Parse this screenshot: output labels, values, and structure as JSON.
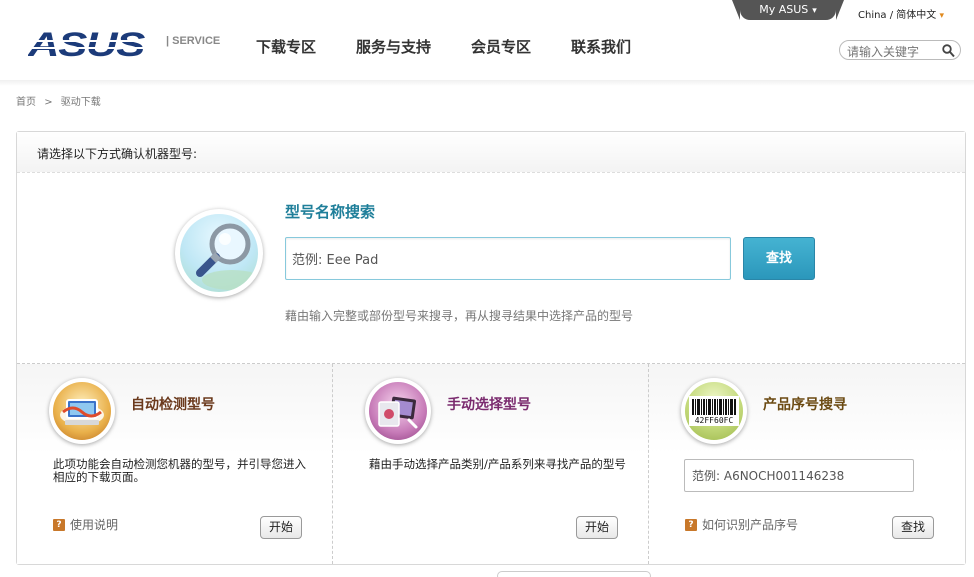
{
  "topbar": {
    "myasus_label": "My ASUS",
    "myasus_caret": "▾",
    "region_label": "China / 简体中文",
    "region_arrow": "▾"
  },
  "header": {
    "logo_text": "ASUS",
    "service_label": "| SERVICE",
    "nav": [
      {
        "label": "下载专区"
      },
      {
        "label": "服务与支持"
      },
      {
        "label": "会员专区"
      },
      {
        "label": "联系我们"
      }
    ],
    "search": {
      "placeholder": "请输入关键字"
    }
  },
  "breadcrumb": {
    "home": "首页",
    "sep": ">",
    "current": "驱动下载"
  },
  "panel": {
    "heading": "请选择以下方式确认机器型号:",
    "model_search": {
      "title": "型号名称搜索",
      "input_value": "范例: Eee Pad",
      "button_label": "查找",
      "hint": "藉由输入完整或部份型号来搜寻，再从搜寻结果中选择产品的型号"
    },
    "columns": [
      {
        "title": "自动检测型号",
        "title_color": "#6b3a1d",
        "description": "此项功能会自动检测您机器的型号，并引导您进入相应的下载页面。",
        "help": "使用说明",
        "button_label": "开始"
      },
      {
        "title": "手动选择型号",
        "title_color": "#7a2a6e",
        "description": "藉由手动选择产品类别/产品系列来寻找产品的型号",
        "button_label": "开始"
      },
      {
        "title": "产品序号搜寻",
        "title_color": "#6b4a12",
        "input_value": "范例: A6NOCH001146238",
        "barcode_text": "42FF60FC",
        "help": "如何识别产品序号",
        "button_label": "查找"
      }
    ]
  },
  "colors": {
    "accent": "#2b97bb",
    "title_blue": "#1f7f9a",
    "brand_navy": "#1c3b7a"
  }
}
